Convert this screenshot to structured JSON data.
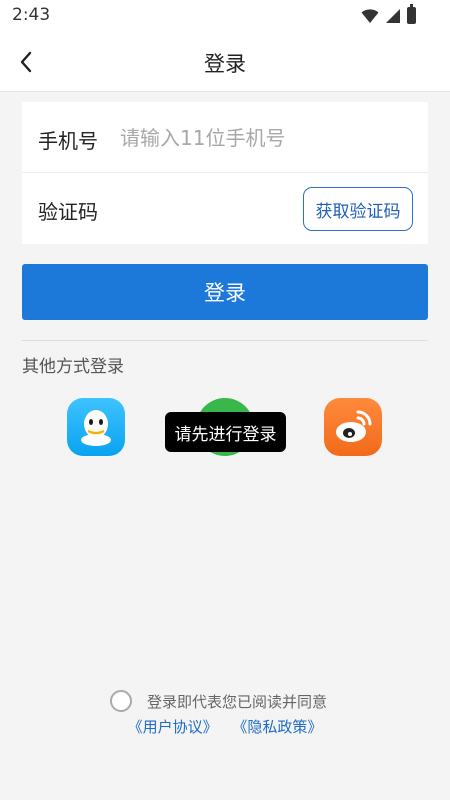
{
  "status_bar": {
    "time": "2:43",
    "icons": [
      "wifi-icon",
      "signal-icon",
      "battery-icon"
    ]
  },
  "app_bar": {
    "back_icon": "chevron-left-icon",
    "title": "登录"
  },
  "form": {
    "phone": {
      "label": "手机号",
      "placeholder": "请输入11位手机号",
      "value": ""
    },
    "code": {
      "label": "验证码",
      "button_label": "获取验证码"
    }
  },
  "login_button": "登录",
  "other_login": {
    "title": "其他方式登录",
    "providers": [
      {
        "name": "QQ",
        "icon": "qq-icon",
        "color": "#12B7F5"
      },
      {
        "name": "WeChat",
        "icon": "wechat-icon",
        "color": "#38B84A"
      },
      {
        "name": "Weibo",
        "icon": "weibo-icon",
        "color": "#F27A2A"
      }
    ]
  },
  "toast": "请先进行登录",
  "agreement": {
    "text": "登录即代表您已阅读并同意",
    "checked": false,
    "user_agreement": "《用户协议》",
    "privacy_policy": "《隐私政策》"
  },
  "colors": {
    "primary": "#1C78D9",
    "link": "#1F6CC8",
    "background": "#F4F4F4"
  }
}
